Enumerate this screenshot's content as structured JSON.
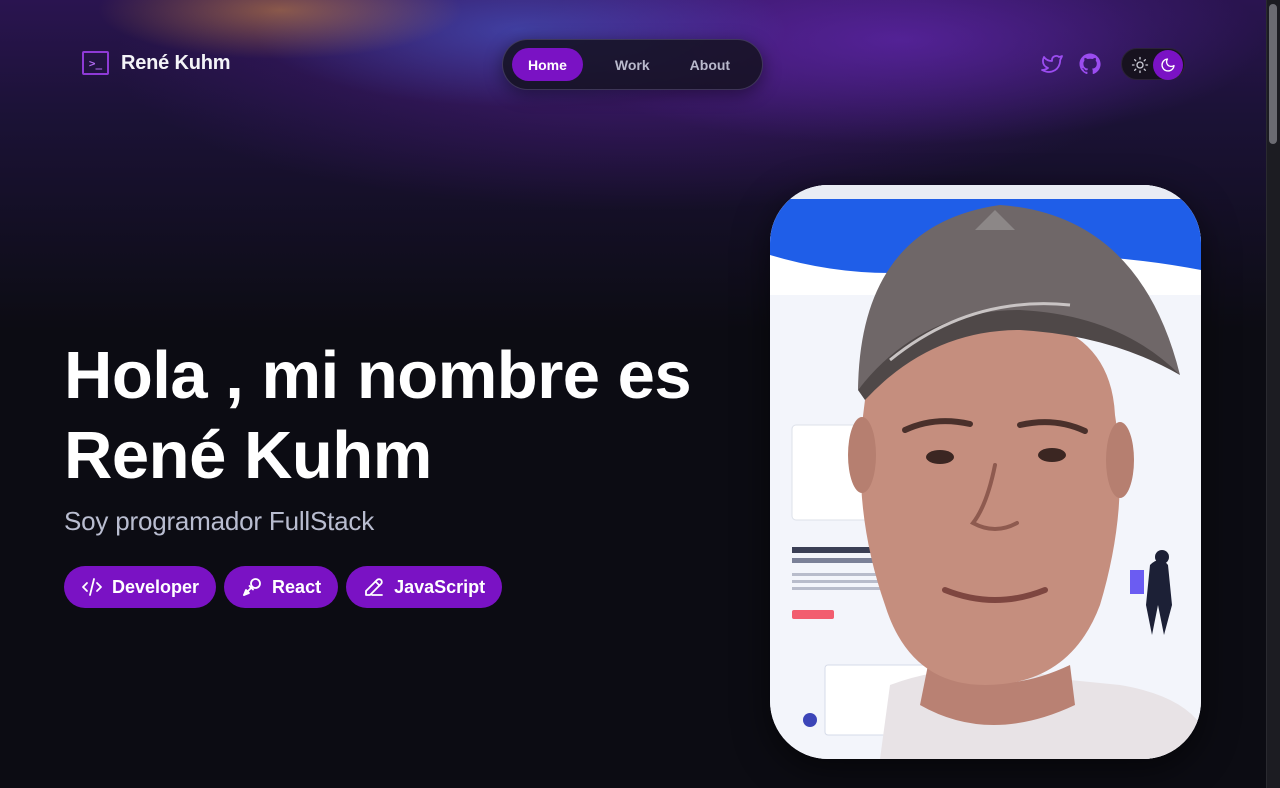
{
  "header": {
    "logo_icon": "terminal-icon",
    "logo_glyph": ">_",
    "site_name": "René Kuhm"
  },
  "nav": {
    "items": [
      {
        "label": "Home",
        "active": true
      },
      {
        "label": "Work",
        "active": false
      },
      {
        "label": "About",
        "active": false
      }
    ]
  },
  "social": {
    "twitter_icon": "twitter-icon",
    "github_icon": "github-icon"
  },
  "theme_toggle": {
    "light_icon": "sun-icon",
    "dark_icon": "moon-icon",
    "selected": "dark"
  },
  "hero": {
    "title": "Hola , mi nombre es René Kuhm",
    "subtitle": "Soy programador FullStack",
    "tags": [
      {
        "label": "Developer",
        "icon": "code-icon"
      },
      {
        "label": "React",
        "icon": "microphone-icon"
      },
      {
        "label": "JavaScript",
        "icon": "pencil-icon"
      }
    ]
  },
  "colors": {
    "accent": "#7a12c4",
    "background": "#0c0c13",
    "subtitle": "#b9bdd0"
  }
}
